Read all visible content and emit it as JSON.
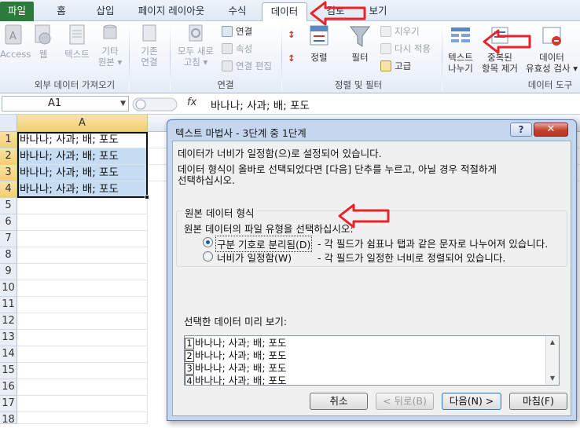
{
  "tabs": [
    "파일",
    "홈",
    "삽입",
    "페이지 레이아웃",
    "수식",
    "데이터",
    "검토",
    "보기"
  ],
  "ribbon": {
    "external": {
      "access": "Access",
      "web": "웹",
      "text": "텍스트",
      "other_1": "기타",
      "other_2": "원본 ▾",
      "existing_1": "기존",
      "existing_2": "연결",
      "group": "외부 데이터 가져오기"
    },
    "connections": {
      "refresh_1": "모두 새로",
      "refresh_2": "고침 ▾",
      "conn": "연결",
      "props": "속성",
      "edit": "연결 편집",
      "group": "연결"
    },
    "sort": {
      "sort": "정렬",
      "filter": "필터",
      "clear": "지우기",
      "reapply": "다시 적용",
      "advanced": "고급",
      "group": "정렬 및 필터"
    },
    "tools": {
      "t2c_1": "텍스트",
      "t2c_2": "나누기",
      "dup_1": "중복된",
      "dup_2": "항목 제거",
      "val_1": "데이터",
      "val_2": "유효성 검사 ▾",
      "group": "데이터 도구"
    }
  },
  "formula_bar": {
    "name_box": "A1",
    "fx": "fx",
    "formula": "바나나; 사과; 배; 포도"
  },
  "grid": {
    "column": "A",
    "rows": [
      "1",
      "2",
      "3",
      "4",
      "5",
      "6",
      "7",
      "8",
      "9",
      "10",
      "11",
      "12",
      "13",
      "14",
      "15",
      "16",
      "17",
      "18"
    ],
    "cells": [
      "바나나; 사과; 배; 포도",
      "바나나; 사과; 배; 포도",
      "바나나; 사과; 배; 포도",
      "바나나; 사과; 배; 포도"
    ]
  },
  "dialog": {
    "title": "텍스트 마법사 - 3단계 중 1단계",
    "help": "?",
    "close": "✕",
    "line1": "데이터가 너비가 일정함(으)로 설정되어 있습니다.",
    "line2": "데이터 형식이 올바로 선택되었다면 [다음] 단추를 누르고, 아닐 경우 적절하게",
    "line3": "선택하십시오.",
    "group_title": "원본 데이터 형식",
    "group_prompt": "원본 데이터의 파일 유형을 선택하십시오:",
    "option1_label": "구분 기호로 분리됨(D)",
    "option1_desc": "- 각 필드가 쉼표나 탭과 같은 문자로 나누어져 있습니다.",
    "option2_label": "너비가 일정함(W)",
    "option2_desc": "- 각 필드가 일정한 너비로 정렬되어 있습니다.",
    "preview_label": "선택한 데이터 미리 보기:",
    "preview": [
      {
        "n": "1",
        "text": "바나나; 사과; 배; 포도"
      },
      {
        "n": "2",
        "text": "바나나; 사과; 배; 포도"
      },
      {
        "n": "3",
        "text": "바나나; 사과; 배; 포도"
      },
      {
        "n": "4",
        "text": "바나나; 사과; 배; 포도"
      }
    ],
    "buttons": {
      "cancel": "취소",
      "back": "< 뒤로(B)",
      "next": "다음(N) >",
      "finish": "마침(F)"
    }
  },
  "colors": {
    "file_tab": "#2b7c3c",
    "selection_fill": "#c6dcf3",
    "annotation": "#e8242a"
  }
}
